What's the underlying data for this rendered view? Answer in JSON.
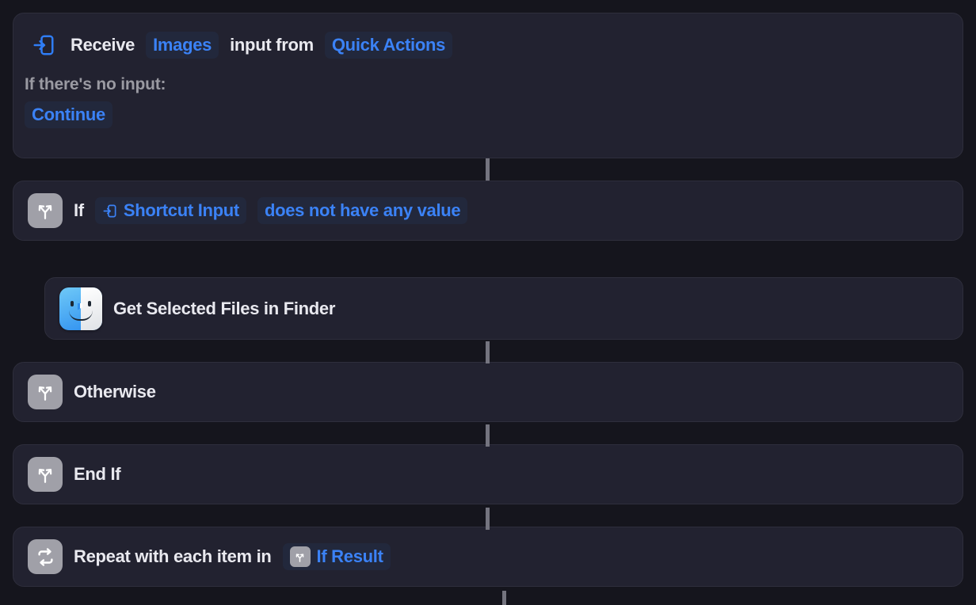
{
  "theme": {
    "page_bg": "#15151d",
    "card_bg": "#222230",
    "card_border": "#2e2e3c",
    "accent_blue": "#3b82f6",
    "token_bg": "#22283c",
    "icon_tile_bg": "#a0a0a8",
    "text_primary": "#e9e9ef",
    "text_secondary": "#9a9aa2",
    "connector": "#74747f"
  },
  "workflow": {
    "receive_card": {
      "icon": "shortcut-input-icon",
      "prefix_label": "Receive",
      "input_type_token": "Images",
      "middle_label": "input from",
      "source_token": "Quick Actions",
      "no_input_label": "If there's no input:",
      "no_input_action_token": "Continue"
    },
    "if_card": {
      "icon": "if-branch-icon",
      "keyword": "If",
      "variable_token": {
        "icon": "shortcut-input-icon",
        "label": "Shortcut Input"
      },
      "condition_token": "does not have any value"
    },
    "finder_card": {
      "icon": "finder-icon",
      "label": "Get Selected Files in Finder"
    },
    "otherwise_card": {
      "icon": "if-branch-icon",
      "label": "Otherwise"
    },
    "endif_card": {
      "icon": "if-branch-icon",
      "label": "End If"
    },
    "repeat_card": {
      "icon": "repeat-icon",
      "label": "Repeat with each item in",
      "variable_token": {
        "icon": "if-branch-icon",
        "label": "If Result"
      }
    }
  }
}
